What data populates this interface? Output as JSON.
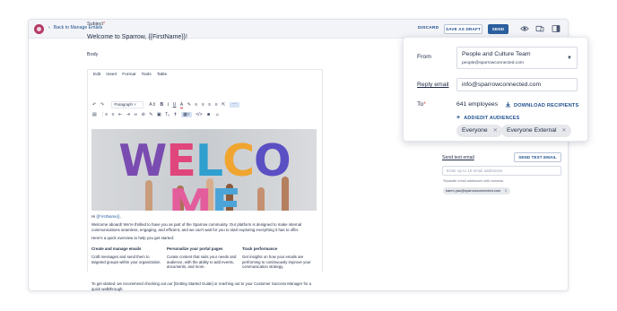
{
  "topbar": {
    "back_label": "Back to Manage Emails",
    "discard_label": "DISCARD",
    "save_draft_label": "SAVE AS DRAFT",
    "send_label": "SEND",
    "icons": [
      "app-logo-icon",
      "chevron-left-icon",
      "eye-icon",
      "mobile-preview-icon",
      "panel-toggle-icon"
    ]
  },
  "subject": {
    "label": "Subject",
    "required_mark": "*",
    "value": "Welcome to Sparrow, {{FirstName}}!"
  },
  "body": {
    "label": "Body"
  },
  "editor": {
    "menu": [
      "Edit",
      "Insert",
      "Format",
      "Tools",
      "Table"
    ],
    "paragraph_style": "Paragraph",
    "font_size_label": "A"
  },
  "banner": {
    "text": "WELCOME",
    "letter_colors": [
      "#7a4bb0",
      "#e0457b",
      "#2f9fd0",
      "#f0a531",
      "#5b4fc4",
      "#e35d9c",
      "#4ba4d8"
    ]
  },
  "email_body": {
    "greeting_prefix": "Hi ",
    "greeting_name": "{{FirstName}}",
    "greeting_suffix": ",",
    "intro": "Welcome aboard! We're thrilled to have you as part of the Sparrow community. Our platform is designed to make internal communications seamless, engaging, and efficient, and we can't wait for you to start exploring everything it has to offer.",
    "overview": "Here's a quick overview to help you get started:",
    "columns": [
      {
        "title": "Create and manage emails",
        "text": "Craft messages and send them to targeted groups within your organization."
      },
      {
        "title": "Personalize your portal pages",
        "text": "Curate content that suits your needs and audience, with the ability to add events, documents, and more."
      },
      {
        "title": "Track performance",
        "text": "Get insights on how your emails are performing to continuously improve your communication strategy."
      }
    ],
    "outro": "To get started, we recommend checking out our [Getting Started Guide] or reaching out to your Customer Success Manager for a quick walkthrough."
  },
  "test_email": {
    "link_label": "Send test email",
    "button_label": "SEND TEST EMAIL",
    "input_placeholder": "Enter up to 10 email addresses",
    "hint": "Separate email addresses with commas",
    "chip_email": "karen.yao@sparrowconnected.com"
  },
  "sender": {
    "from_label": "From",
    "from_name": "People and Culture Team",
    "from_email": "people@sparrowconnected.com",
    "reply_label": "Reply email",
    "reply_value": "info@sparrowconnected.com",
    "to_label": "To",
    "to_required": "*",
    "to_count": "641 employees",
    "download_label": "DOWNLOAD RECIPIENTS",
    "add_audiences_label": "ADD/EDIT AUDIENCES",
    "audiences": [
      "Everyone",
      "Everyone External"
    ]
  },
  "colors": {
    "brand_blue": "#2b5f9e",
    "link_blue": "#1f4f8f",
    "logo": "#b43a66",
    "required": "#d23b3b"
  }
}
